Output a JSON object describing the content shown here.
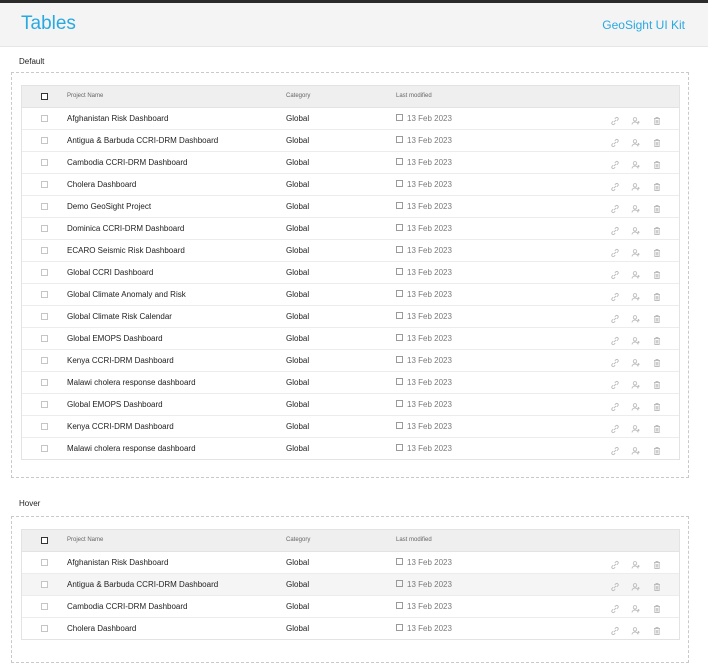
{
  "header": {
    "title": "Tables",
    "kit_link": "GeoSight UI Kit"
  },
  "sections": {
    "default": {
      "label": "Default",
      "columns": {
        "name": "Project Name",
        "category": "Category",
        "modified": "Last modified"
      },
      "rows": [
        {
          "name": "Afghanistan Risk Dashboard",
          "category": "Global",
          "modified": "13 Feb 2023"
        },
        {
          "name": "Antigua & Barbuda CCRI-DRM Dashboard",
          "category": "Global",
          "modified": "13 Feb 2023"
        },
        {
          "name": "Cambodia CCRI-DRM Dashboard",
          "category": "Global",
          "modified": "13 Feb 2023"
        },
        {
          "name": "Cholera Dashboard",
          "category": "Global",
          "modified": "13 Feb 2023"
        },
        {
          "name": "Demo GeoSight Project",
          "category": "Global",
          "modified": "13 Feb 2023"
        },
        {
          "name": "Dominica CCRI-DRM Dashboard",
          "category": "Global",
          "modified": "13 Feb 2023"
        },
        {
          "name": "ECARO Seismic Risk Dashboard",
          "category": "Global",
          "modified": "13 Feb 2023"
        },
        {
          "name": "Global CCRI Dashboard",
          "category": "Global",
          "modified": "13 Feb 2023"
        },
        {
          "name": "Global Climate Anomaly and Risk",
          "category": "Global",
          "modified": "13 Feb 2023"
        },
        {
          "name": "Global Climate Risk Calendar",
          "category": "Global",
          "modified": "13 Feb 2023"
        },
        {
          "name": "Global EMOPS Dashboard",
          "category": "Global",
          "modified": "13 Feb 2023"
        },
        {
          "name": "Kenya CCRI-DRM Dashboard",
          "category": "Global",
          "modified": "13 Feb 2023"
        },
        {
          "name": "Malawi cholera response dashboard",
          "category": "Global",
          "modified": "13 Feb 2023"
        },
        {
          "name": "Global EMOPS Dashboard",
          "category": "Global",
          "modified": "13 Feb 2023"
        },
        {
          "name": "Kenya CCRI-DRM Dashboard",
          "category": "Global",
          "modified": "13 Feb 2023"
        },
        {
          "name": "Malawi cholera response dashboard",
          "category": "Global",
          "modified": "13 Feb 2023"
        }
      ]
    },
    "hover": {
      "label": "Hover",
      "columns": {
        "name": "Project Name",
        "category": "Category",
        "modified": "Last modified"
      },
      "rows": [
        {
          "name": "Afghanistan Risk Dashboard",
          "category": "Global",
          "modified": "13 Feb 2023"
        },
        {
          "name": "Antigua & Barbuda CCRI-DRM Dashboard",
          "category": "Global",
          "modified": "13 Feb 2023",
          "hovered": true
        },
        {
          "name": "Cambodia CCRI-DRM Dashboard",
          "category": "Global",
          "modified": "13 Feb 2023"
        },
        {
          "name": "Cholera Dashboard",
          "category": "Global",
          "modified": "13 Feb 2023"
        }
      ]
    }
  },
  "row_actions": [
    "link-icon",
    "add-user-icon",
    "trash-icon"
  ],
  "colors": {
    "accent": "#29a9e1",
    "header_bg": "#f4f4f4",
    "table_head_bg": "#efefef",
    "hover_row_bg": "#f5f5f5"
  }
}
